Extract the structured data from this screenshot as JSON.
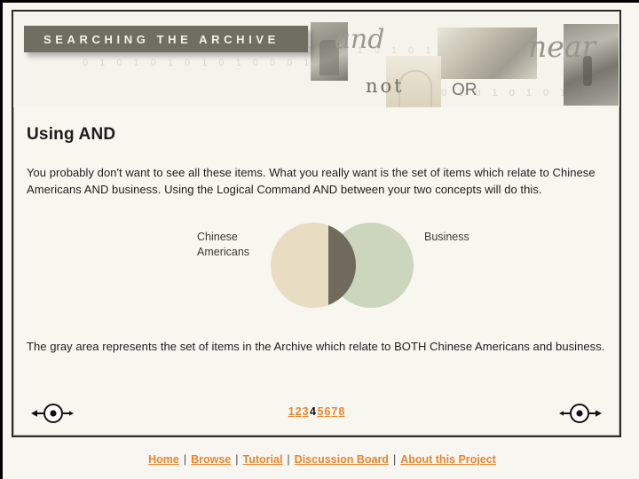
{
  "header": {
    "title": "SEARCHING THE ARCHIVE",
    "binary_rows": [
      "0 1 0 1 0 1 0 1 0 1 0 0 0 1",
      "0 1 0 1 0 1 0 1",
      "0 1 0 1 0 1 0 1 0 0 0 1 1"
    ],
    "operator_words": {
      "and": "and",
      "not": "not",
      "or": "OR",
      "near": "near"
    },
    "photo_alt": [
      "archival-portrait-photo",
      "archival-arch-drawing",
      "archival-street-scene-photo",
      "archival-figure-photo"
    ]
  },
  "main": {
    "page_title": "Using AND",
    "intro_paragraph": "You probably don't want to see all these items. What you really want is the set of items which relate to Chinese Americans AND business. Using the Logical Command AND between your two concepts will do this.",
    "closing_paragraph": "The gray area represents the set of items in the Archive which relate to BOTH Chinese Americans and business."
  },
  "venn": {
    "left_label": "Chinese Americans",
    "right_label": "Business",
    "left_color": "#e8dcc2",
    "right_color": "#cbd6bd",
    "overlap_color": "#6f6a5b"
  },
  "pager": {
    "pages": [
      "1",
      "2",
      "3",
      "4",
      "5",
      "6",
      "7",
      "8"
    ],
    "current": "4",
    "prev_label": "previous page",
    "next_label": "next page"
  },
  "footer": {
    "links": [
      "Home",
      "Browse",
      "Tutorial",
      "Discussion Board",
      "About this Project"
    ],
    "separator": "|",
    "link_color": "#e8852e"
  }
}
